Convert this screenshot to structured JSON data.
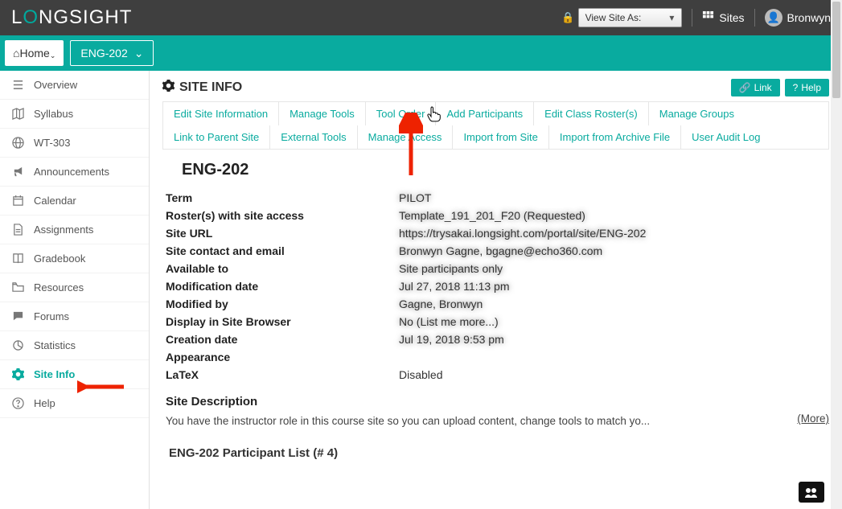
{
  "topbar": {
    "logo": "LONGSIGHT",
    "view_as_label": "View Site As:",
    "sites_label": "Sites",
    "user_name": "Bronwyn"
  },
  "navbar": {
    "home_label": "Home",
    "course_label": "ENG-202"
  },
  "sidebar": {
    "items": [
      {
        "id": "overview",
        "label": "Overview",
        "icon": "list"
      },
      {
        "id": "syllabus",
        "label": "Syllabus",
        "icon": "map"
      },
      {
        "id": "wt-303",
        "label": "WT-303",
        "icon": "globe"
      },
      {
        "id": "announcements",
        "label": "Announcements",
        "icon": "bullhorn"
      },
      {
        "id": "calendar",
        "label": "Calendar",
        "icon": "calendar"
      },
      {
        "id": "assignments",
        "label": "Assignments",
        "icon": "file"
      },
      {
        "id": "gradebook",
        "label": "Gradebook",
        "icon": "book"
      },
      {
        "id": "resources",
        "label": "Resources",
        "icon": "folder"
      },
      {
        "id": "forums",
        "label": "Forums",
        "icon": "chat"
      },
      {
        "id": "statistics",
        "label": "Statistics",
        "icon": "pie"
      },
      {
        "id": "site-info",
        "label": "Site Info",
        "icon": "gear",
        "active": true
      },
      {
        "id": "help",
        "label": "Help",
        "icon": "question"
      }
    ]
  },
  "content": {
    "tool_title": "SITE INFO",
    "link_btn": "Link",
    "help_btn": "Help",
    "tabs": [
      "Edit Site Information",
      "Manage Tools",
      "Tool Order",
      "Add Participants",
      "Edit Class Roster(s)",
      "Manage Groups",
      "Link to Parent Site",
      "External Tools",
      "Manage Access",
      "Import from Site",
      "Import from Archive File",
      "User Audit Log"
    ],
    "site_title": "ENG-202",
    "info_rows": [
      {
        "label": "Term",
        "value": "PILOT",
        "blur": true
      },
      {
        "label": "Roster(s) with site access",
        "value": "Template_191_201_F20 (Requested)",
        "blur": true
      },
      {
        "label": "Site URL",
        "value": "https://trysakai.longsight.com/portal/site/ENG-202",
        "blur": true
      },
      {
        "label": "Site contact and email",
        "value": "Bronwyn Gagne, bgagne@echo360.com",
        "blur": true
      },
      {
        "label": "Available to",
        "value": "Site participants only",
        "blur": true
      },
      {
        "label": "Modification date",
        "value": "Jul 27, 2018 11:13 pm",
        "blur": true
      },
      {
        "label": "Modified by",
        "value": "Gagne, Bronwyn",
        "blur": true
      },
      {
        "label": "Display in Site Browser",
        "value": "No (List me more...)",
        "blur": true
      },
      {
        "label": "Creation date",
        "value": "Jul 19, 2018 9:53 pm",
        "blur": true
      },
      {
        "label": "Appearance",
        "value": "",
        "blur": false
      },
      {
        "label": "LaTeX",
        "value": "Disabled",
        "blur": false
      }
    ],
    "site_desc_heading": "Site Description",
    "site_desc_text": "You have the instructor role in this course site so you can upload content, change tools to match yo...",
    "more_label": "(More)",
    "participant_heading": "ENG-202 Participant List (# 4)"
  }
}
